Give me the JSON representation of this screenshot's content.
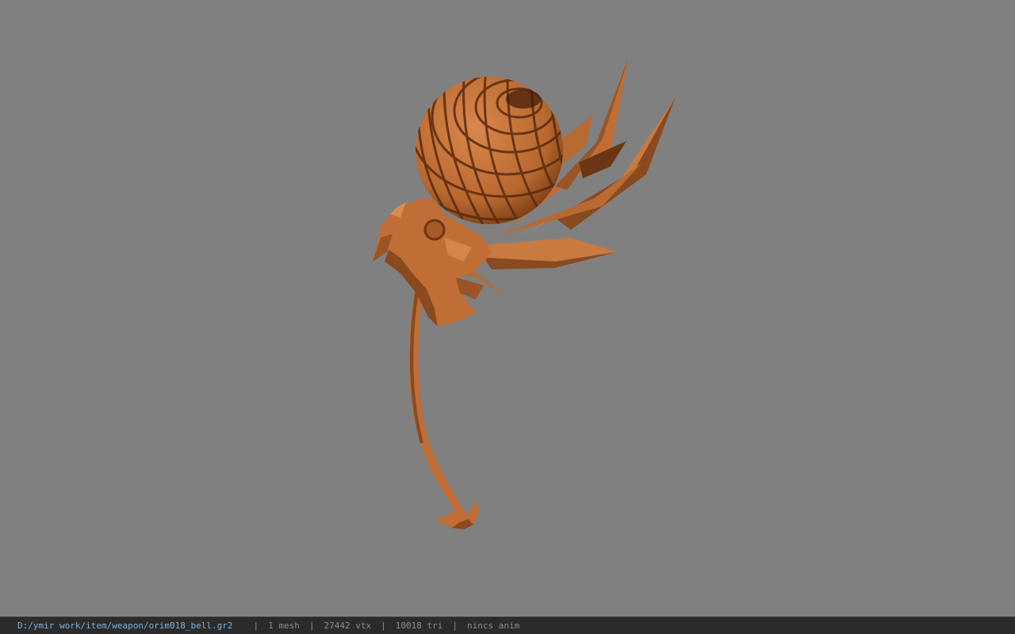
{
  "viewer": {
    "background_color": "#808080",
    "model_color": "#c8753e",
    "model_shadow_color": "#6b3616"
  },
  "status_bar": {
    "file_path": "D:/ymir work/item/weapon/orim018_bell.gr2",
    "separator": "|",
    "mesh_count": "1 mesh",
    "vertex_count": "27442 vtx",
    "triangle_count": "10018 tri",
    "anim_status": "nincs anim"
  }
}
